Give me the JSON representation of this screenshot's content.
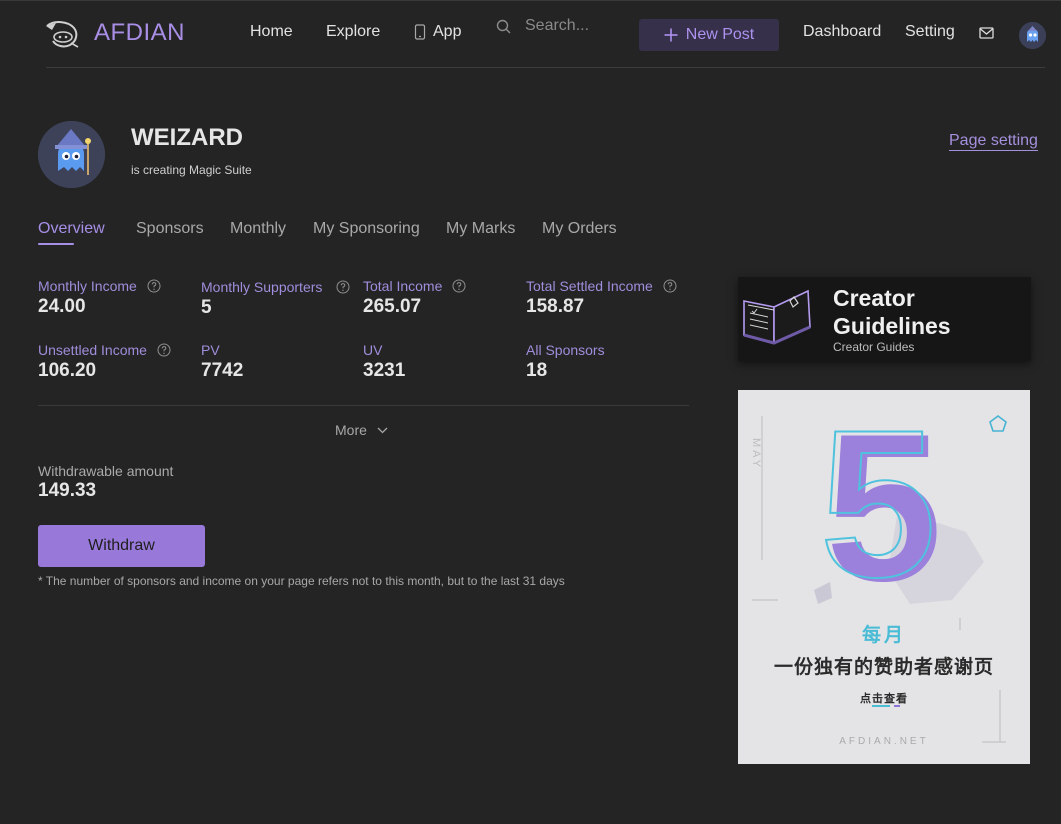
{
  "header": {
    "brand": "AFDIAN",
    "nav": [
      {
        "label": "Home"
      },
      {
        "label": "Explore"
      },
      {
        "label": "App"
      }
    ],
    "search_placeholder": "Search...",
    "new_post_label": "New Post",
    "links": [
      {
        "label": "Dashboard"
      },
      {
        "label": "Setting"
      }
    ]
  },
  "profile": {
    "name": "WEIZARD",
    "subtitle": "is creating Magic Suite",
    "page_setting_label": "Page setting"
  },
  "tabs": [
    {
      "label": "Overview",
      "active": true
    },
    {
      "label": "Sponsors"
    },
    {
      "label": "Monthly"
    },
    {
      "label": "My Sponsoring"
    },
    {
      "label": "My Marks"
    },
    {
      "label": "My Orders"
    }
  ],
  "stats": [
    {
      "label": "Monthly Income",
      "value": "24.00",
      "help": true
    },
    {
      "label": "Monthly Supporters",
      "value": "5",
      "help": true
    },
    {
      "label": "Total Income",
      "value": "265.07",
      "help": true
    },
    {
      "label": "Total Settled Income",
      "value": "158.87",
      "help": true
    },
    {
      "label": "Unsettled Income",
      "value": "106.20",
      "help": true
    },
    {
      "label": "PV",
      "value": "7742"
    },
    {
      "label": "UV",
      "value": "3231"
    },
    {
      "label": "All Sponsors",
      "value": "18"
    }
  ],
  "more_label": "More",
  "withdraw": {
    "label": "Withdrawable amount",
    "amount": "149.33",
    "button_label": "Withdraw",
    "note": "* The number of sponsors and income on your page refers not to this month, but to the last 31 days"
  },
  "sidebar": {
    "guide_title": "Creator Guidelines",
    "guide_subtitle": "Creator Guides",
    "banner": {
      "month_label": "MAY",
      "big_number": "5",
      "monthly": "每月",
      "headline": "一份独有的赞助者感谢页",
      "cta": "点击查看",
      "site": "AFDIAN.NET"
    }
  },
  "colors": {
    "background": "#242424",
    "accent": "#a68fe6",
    "button": "#9879da",
    "new_post_bg": "#37304a"
  },
  "icons": [
    "logo-icon",
    "phone-icon",
    "search-icon",
    "plus-icon",
    "mail-icon",
    "help-icon",
    "chevron-down-icon",
    "book-icon"
  ]
}
